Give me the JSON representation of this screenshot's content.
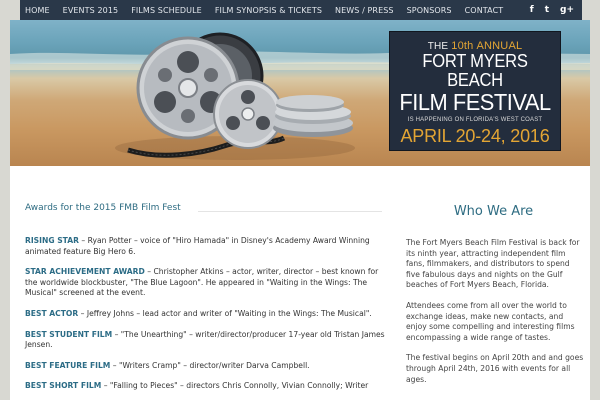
{
  "nav": {
    "items": [
      "HOME",
      "EVENTS 2015",
      "FILMS SCHEDULE",
      "FILM SYNOPSIS & TICKETS",
      "NEWS / PRESS",
      "SPONSORS",
      "CONTACT"
    ],
    "social": [
      "f",
      "t",
      "g+"
    ],
    "background": "#2a3849"
  },
  "poster": {
    "the": "THE",
    "annual_number": "10th",
    "annual": "ANNUAL",
    "title_line1": "FORT MYERS BEACH",
    "title_line2": "FILM FESTIVAL",
    "subtitle": "IS HAPPENING ON FLORIDA'S WEST COAST",
    "dates": "APRIL 20-24, 2016",
    "accent": "#e3a534"
  },
  "awards": {
    "title": "Awards for the 2015 FMB Film Fest",
    "items": [
      {
        "label": "RISING STAR",
        "text": " – Ryan Potter – voice of \"Hiro Hamada\" in Disney's Academy Award Winning animated feature Big Hero 6."
      },
      {
        "label": "STAR ACHIEVEMENT AWARD",
        "text": " – Christopher Atkins – actor, writer, director – best known for the worldwide blockbuster, \"The Blue Lagoon\". He appeared in \"Waiting in the Wings: The Musical\" screened at the event."
      },
      {
        "label": "BEST ACTOR",
        "text": " – Jeffrey Johns – lead actor and writer of \"Waiting in the Wings: The Musical\"."
      },
      {
        "label": "BEST STUDENT FILM",
        "text": " – \"The Unearthing\" – writer/director/producer 17-year old Tristan James Jensen."
      },
      {
        "label": "BEST FEATURE FILM",
        "text": " – \"Writers Cramp\" – director/writer Darva Campbell."
      },
      {
        "label": "BEST SHORT FILM",
        "text": " – \"Falling to Pieces\" – directors Chris Connolly, Vivian Connolly; Writer"
      }
    ]
  },
  "who_we_are": {
    "title": "Who We Are",
    "paragraphs": [
      "The Fort Myers Beach Film Festival is back for its ninth year, attracting independent film fans, filmmakers, and distributors to spend five fabulous days and nights on the Gulf beaches of Fort Myers Beach, Florida.",
      "Attendees come from all over the world to exchange ideas, make new contacts, and enjoy some compelling and interesting films encompassing a wide range of tastes.",
      "The festival begins on April 20th and and goes through April 24th, 2016 with events for all ages."
    ]
  },
  "colors": {
    "heading": "#2e6c82",
    "award_label": "#2c6c86"
  }
}
